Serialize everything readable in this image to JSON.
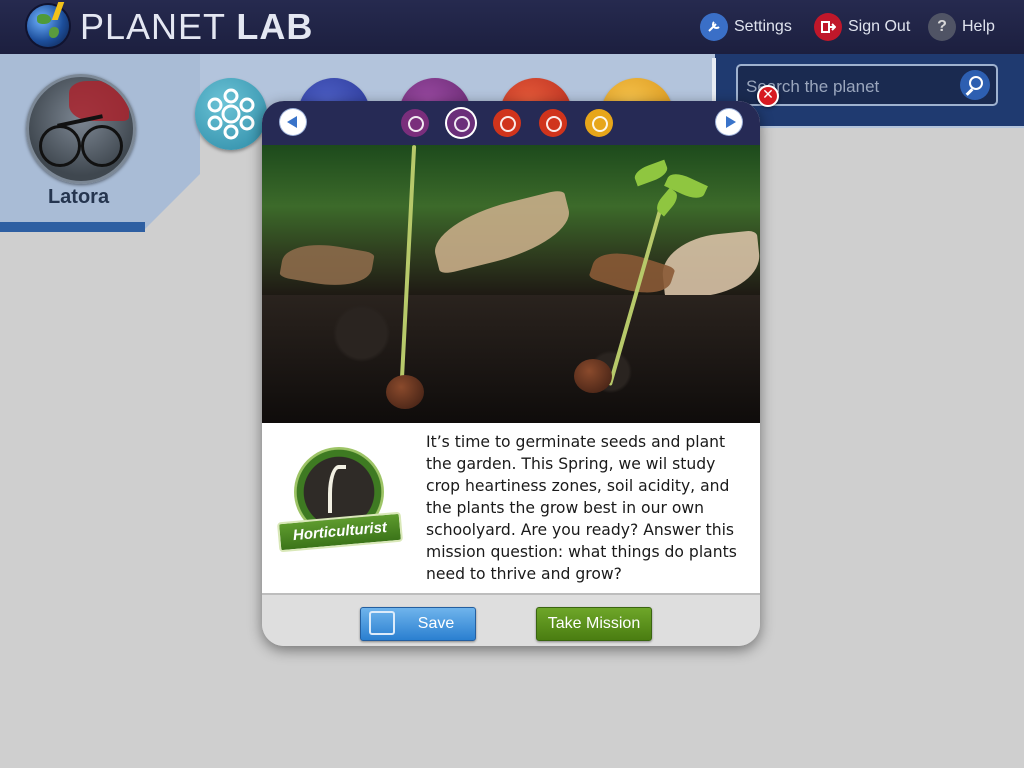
{
  "app": {
    "brand_light": "PLANET ",
    "brand_bold": "LAB"
  },
  "header": {
    "settings_label": "Settings",
    "signout_label": "Sign Out",
    "help_label": "Help",
    "help_icon_glyph": "?"
  },
  "user": {
    "name": "Latora"
  },
  "search": {
    "placeholder": "Search the planet"
  },
  "mission_nav": {
    "dots": [
      {
        "name": "community-icon",
        "color": "#7a2e7c",
        "active": false
      },
      {
        "name": "community-icon",
        "color": "#6b2f7a",
        "active": true
      },
      {
        "name": "flower-icon",
        "color": "#d0341c",
        "active": false
      },
      {
        "name": "flower-icon",
        "color": "#d0341c",
        "active": false
      },
      {
        "name": "honeycomb-icon",
        "color": "#e7a61a",
        "active": false
      }
    ]
  },
  "mission": {
    "badge_label": "Horticulturist",
    "description": "It’s time to germinate seeds and plant the garden. This Spring, we wil study crop heartiness zones, soil acidity, and the plants the grow best in our own schoolyard. Are you ready? Answer this mission question: what things do plants need to thrive and grow?",
    "save_label": "Save",
    "take_label": "Take Mission",
    "close_glyph": "✕"
  },
  "colors": {
    "header_bg": "#1f2245",
    "band": "#b3c4dc",
    "accent_blue": "#2a7fd0",
    "accent_green": "#4a7d11",
    "close_red": "#d71a21"
  }
}
